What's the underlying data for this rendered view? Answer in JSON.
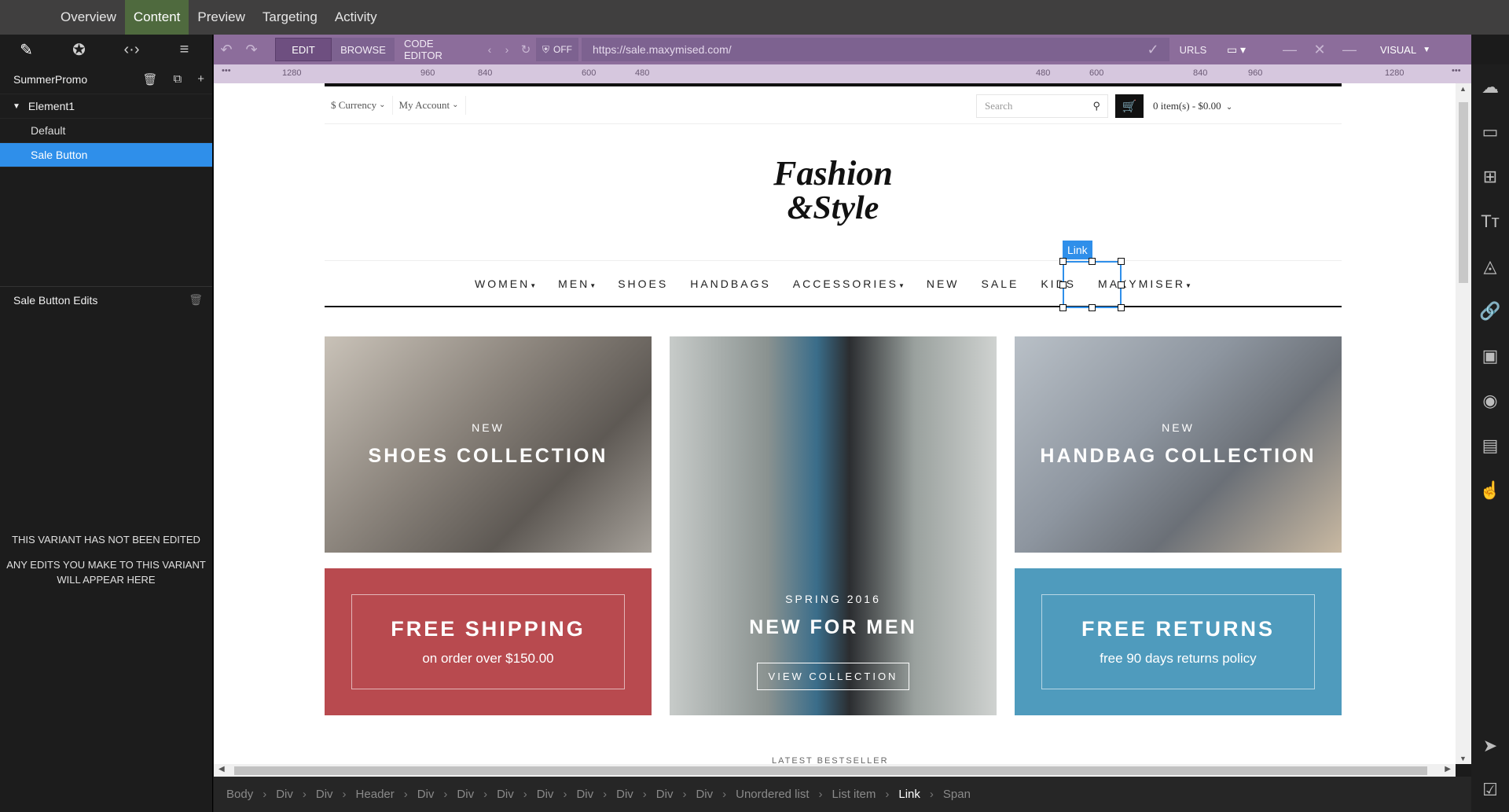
{
  "topnav": {
    "tabs": [
      "Overview",
      "Content",
      "Preview",
      "Targeting",
      "Activity"
    ],
    "active": "Content"
  },
  "leftpanel": {
    "campaign": "SummerPromo",
    "element": "Element1",
    "variants": [
      "Default",
      "Sale Button"
    ],
    "selected_variant": "Sale Button",
    "edits_title": "Sale Button Edits",
    "empty_line1": "THIS VARIANT HAS NOT BEEN EDITED",
    "empty_line2": "ANY EDITS YOU MAKE TO THIS VARIANT WILL APPEAR HERE"
  },
  "toolbar": {
    "edit": "EDIT",
    "browse": "BROWSE",
    "code_editor": "CODE EDITOR",
    "off": "OFF",
    "url": "https://sale.maxymised.com/",
    "urls": "URLS",
    "visual": "VISUAL"
  },
  "ruler": {
    "labels": [
      "1280",
      "960",
      "840",
      "600",
      "480",
      "480",
      "600",
      "840",
      "960",
      "1280"
    ]
  },
  "site": {
    "currency": "$ Currency",
    "account": "My Account",
    "search_placeholder": "Search",
    "cart_info": "0 item(s) - $0.00",
    "logo_line1": "Fashion",
    "logo_line2": "&Style",
    "menu": [
      "WOMEN",
      "MEN",
      "SHOES",
      "HANDBAGS",
      "ACCESSORIES",
      "NEW",
      "SALE",
      "KIDS",
      "MAXYMISER"
    ],
    "selection_label": "Link",
    "tiles": {
      "shoes": {
        "kicker": "NEW",
        "title": "SHOES COLLECTION"
      },
      "men": {
        "kicker": "SPRING 2016",
        "title": "NEW FOR MEN",
        "button": "VIEW COLLECTION"
      },
      "handbag": {
        "kicker": "NEW",
        "title": "HANDBAG COLLECTION"
      },
      "shipping": {
        "title": "FREE SHIPPING",
        "sub": "on order over $150.00"
      },
      "returns": {
        "title": "FREE RETURNS",
        "sub": "free 90 days returns policy"
      }
    },
    "tabs_peek": "LATEST      BESTSELLER"
  },
  "breadcrumbs": [
    "Body",
    "Div",
    "Div",
    "Header",
    "Div",
    "Div",
    "Div",
    "Div",
    "Div",
    "Div",
    "Div",
    "Div",
    "Unordered list",
    "List item",
    "Link",
    "Span"
  ],
  "breadcrumb_active": "Link",
  "colors": {
    "accent": "#2f8fea",
    "toolbar": "#8c6d9b",
    "active_tab": "#4f6a3e",
    "shipping": "#b84a4f",
    "returns": "#4f9bbd"
  }
}
